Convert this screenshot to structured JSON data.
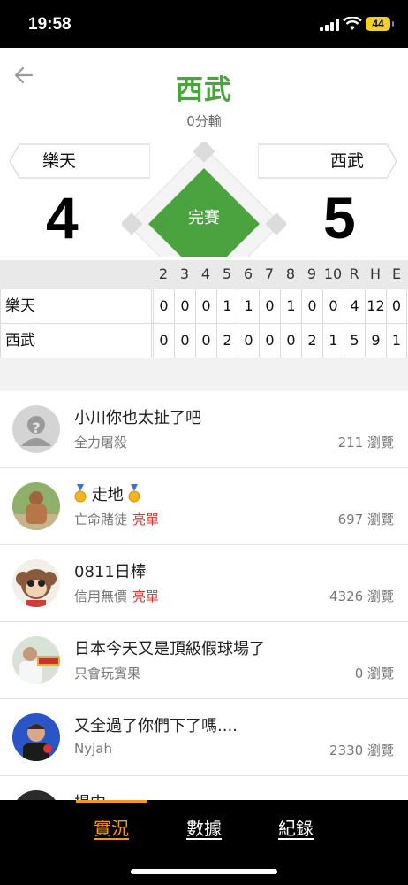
{
  "status_bar": {
    "time": "19:58",
    "battery": "44"
  },
  "game": {
    "winner": "西武",
    "margin": "0分輸",
    "status": "完賽",
    "away": {
      "name": "樂天",
      "score": "4"
    },
    "home": {
      "name": "西武",
      "score": "5"
    }
  },
  "linescore": {
    "headers": [
      "2",
      "3",
      "4",
      "5",
      "6",
      "7",
      "8",
      "9",
      "10",
      "R",
      "H",
      "E"
    ],
    "rows": [
      {
        "team": "樂天",
        "values": [
          "0",
          "0",
          "0",
          "1",
          "1",
          "0",
          "1",
          "0",
          "0",
          "4",
          "12",
          "0"
        ]
      },
      {
        "team": "西武",
        "values": [
          "0",
          "0",
          "0",
          "2",
          "0",
          "0",
          "0",
          "2",
          "1",
          "5",
          "9",
          "1"
        ]
      }
    ]
  },
  "posts": [
    {
      "title": "小川你也太扯了吧",
      "author": "全力屠殺",
      "badge": "",
      "views": "211 瀏覽",
      "avatar": "default-avatar"
    },
    {
      "title": "走地",
      "author": "亡命賭徒",
      "badge": "亮單",
      "views": "697 瀏覽",
      "avatar": "user-photo-shirtless",
      "medals": true
    },
    {
      "title": "0811日棒",
      "author": "信用無價",
      "badge": "亮單",
      "views": "4326 瀏覽",
      "avatar": "user-photo-monkey"
    },
    {
      "title": "日本今天又是頂級假球場了",
      "author": "只會玩賓果",
      "badge": "",
      "views": "0 瀏覽",
      "avatar": "user-photo-man"
    },
    {
      "title": "又全過了你們下了嗎....",
      "author": "Nyjah",
      "badge": "",
      "views": "2330 瀏覽",
      "avatar": "user-photo-golfer"
    },
    {
      "title": "場中",
      "author": "",
      "badge": "",
      "views": "",
      "avatar": "user-photo-partial"
    }
  ],
  "tabs": [
    {
      "label": "實況",
      "active": true
    },
    {
      "label": "數據",
      "active": false
    },
    {
      "label": "紀錄",
      "active": false
    }
  ],
  "colors": {
    "accent_green": "#4aa33f",
    "tab_active": "#f29a12",
    "badge_red": "#e03131"
  }
}
